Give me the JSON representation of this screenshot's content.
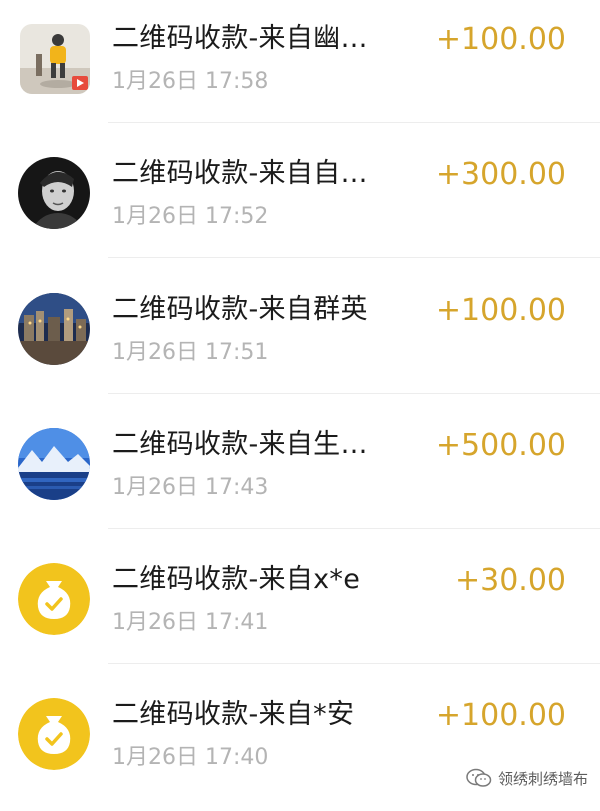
{
  "transactions": [
    {
      "title": "二维码收款-来自幽…",
      "time": "1月26日 17:58",
      "amount": "+100.00",
      "avatar_icon": "photo-avatar-yellow-figure"
    },
    {
      "title": "二维码收款-来自自…",
      "time": "1月26日 17:52",
      "amount": "+300.00",
      "avatar_icon": "photo-avatar-man-portrait"
    },
    {
      "title": "二维码收款-来自群英",
      "time": "1月26日 17:51",
      "amount": "+100.00",
      "avatar_icon": "photo-avatar-night-city"
    },
    {
      "title": "二维码收款-来自生…",
      "time": "1月26日 17:43",
      "amount": "+500.00",
      "avatar_icon": "photo-avatar-blue-landscape"
    },
    {
      "title": "二维码收款-来自x*e",
      "time": "1月26日 17:41",
      "amount": "+30.00",
      "avatar_icon": "money-bag-icon"
    },
    {
      "title": "二维码收款-来自*安",
      "time": "1月26日 17:40",
      "amount": "+100.00",
      "avatar_icon": "money-bag-icon"
    }
  ],
  "watermark": {
    "text": "领绣刺绣墙布",
    "icon": "wechat-icon"
  },
  "colors": {
    "amount": "#d6a52c",
    "time": "#b4b4b4",
    "title": "#1b1b1b",
    "money_bag": "#f2c41d"
  }
}
